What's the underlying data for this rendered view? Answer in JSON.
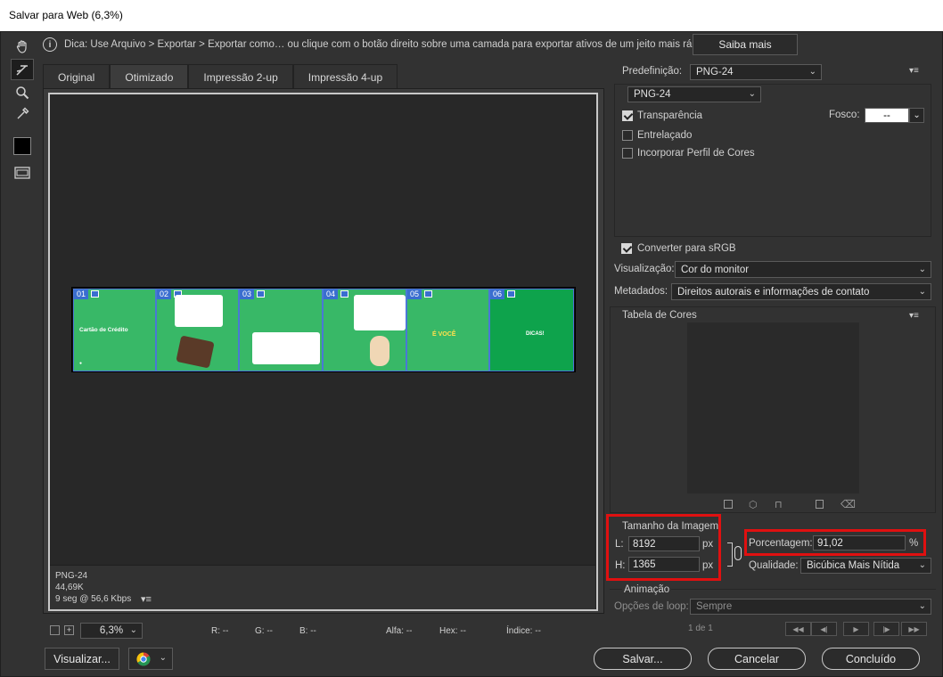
{
  "window": {
    "title": "Salvar para Web (6,3%)"
  },
  "hint": {
    "text": "Dica: Use Arquivo > Exportar > Exportar como… ou clique com o botão direito sobre uma camada para exportar ativos de um jeito mais rápido",
    "learn_more": "Saiba mais"
  },
  "tabs": [
    "Original",
    "Otimizado",
    "Impressão 2-up",
    "Impressão 4-up"
  ],
  "slices": [
    {
      "num": "01",
      "text": "Cartão de Crédito"
    },
    {
      "num": "02",
      "text": ""
    },
    {
      "num": "03",
      "text": ""
    },
    {
      "num": "04",
      "text": ""
    },
    {
      "num": "05",
      "text": "É VOCÊ"
    },
    {
      "num": "06",
      "text": "DICAS!"
    }
  ],
  "preview_info": {
    "format": "PNG-24",
    "size": "44,69K",
    "speed": "9 seg @ 56,6 Kbps"
  },
  "statusbar": {
    "zoom": "6,3%",
    "r": "R: --",
    "g": "G: --",
    "b": "B: --",
    "alpha": "Alfa: --",
    "hex": "Hex: --",
    "index": "Índice: --"
  },
  "settings": {
    "preset_label": "Predefinição:",
    "preset_value": "PNG-24",
    "format_value": "PNG-24",
    "transparency": "Transparência",
    "matte_label": "Fosco:",
    "matte_value": "--",
    "interlaced": "Entrelaçado",
    "embed_profile": "Incorporar Perfil de Cores",
    "convert_srgb": "Converter para sRGB",
    "preview_label": "Visualização:",
    "preview_value": "Cor do monitor",
    "metadata_label": "Metadados:",
    "metadata_value": "Direitos autorais e informações de contato"
  },
  "color_table": {
    "title": "Tabela de Cores"
  },
  "image_size": {
    "title": "Tamanho da Imagem",
    "w_label": "L:",
    "w_value": "8192",
    "w_unit": "px",
    "h_label": "H:",
    "h_value": "1365",
    "h_unit": "px",
    "percent_label": "Porcentagem:",
    "percent_value": "91,02",
    "percent_unit": "%",
    "quality_label": "Qualidade:",
    "quality_value": "Bicúbica Mais Nítida"
  },
  "animation": {
    "title": "Animação",
    "loop_label": "Opções de loop:",
    "loop_value": "Sempre",
    "frame_counter": "1 de 1"
  },
  "buttons": {
    "preview": "Visualizar...",
    "save": "Salvar...",
    "cancel": "Cancelar",
    "done": "Concluído"
  },
  "colors": {
    "accent_red": "#e01010",
    "slice_green": "#38b867",
    "slice_blue": "#3a6ecf"
  }
}
